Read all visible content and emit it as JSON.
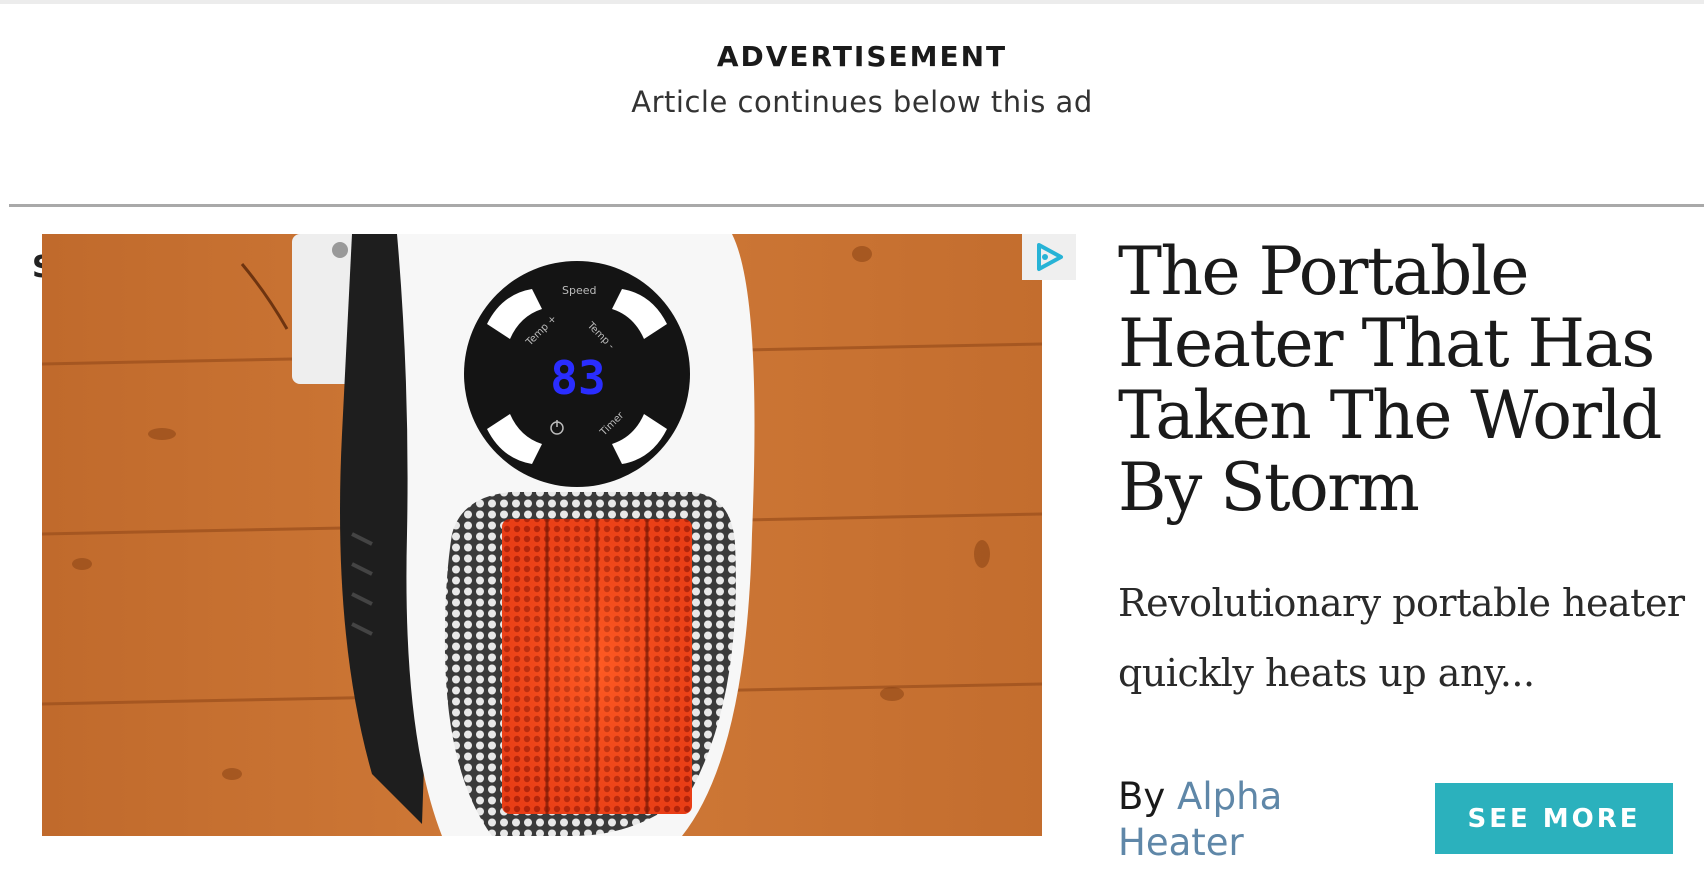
{
  "ad_header": {
    "label": "ADVERTISEMENT",
    "subtitle": "Article continues below this ad"
  },
  "peek_text": "S",
  "ad": {
    "image_alt": "Portable wall plug-in heater with digital display",
    "display_reading": "83",
    "control_labels": [
      "Speed",
      "Temp +",
      "Temp -",
      "Timer"
    ],
    "headline": "The Portable Heater That Has Taken The World By Storm",
    "description": "Revolutionary portable heater quickly heats up any...",
    "by_prefix": "By",
    "advertiser": "Alpha Heater",
    "cta_label": "SEE MORE"
  },
  "colors": {
    "cta_background": "#2bb1bd",
    "advertiser_link": "#5f87a8",
    "adchoices_icon": "#27b3d6"
  },
  "icons": {
    "adchoices": "adchoices-icon",
    "power": "power-icon"
  }
}
